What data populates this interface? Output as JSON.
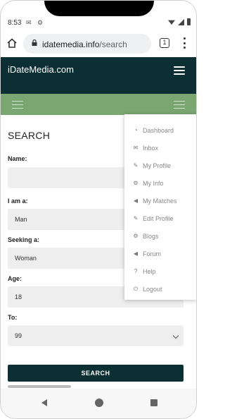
{
  "status": {
    "time": "8:53",
    "left_icons": "✉ ⚙"
  },
  "browser": {
    "url_host": "idatemedia.info",
    "url_path": "/search",
    "tab_count": "1"
  },
  "site": {
    "brand": "iDateMedia.com"
  },
  "form": {
    "title": "SEARCH",
    "name_label": "Name:",
    "name_value": "",
    "iam_label": "I am a:",
    "iam_value": "Man",
    "seeking_label": "Seeking a:",
    "seeking_value": "Woman",
    "age_label": "Age:",
    "age_value": "18",
    "to_label": "To:",
    "to_value": "99",
    "search_button": "SEARCH"
  },
  "menu": {
    "items": [
      {
        "label": "Dashboard",
        "icon": "dashboard-icon",
        "glyph": "◔"
      },
      {
        "label": "Inbox",
        "icon": "envelope-icon",
        "glyph": "✉"
      },
      {
        "label": "My Profile",
        "icon": "edit-icon",
        "glyph": "✎"
      },
      {
        "label": "My Info",
        "icon": "cogs-icon",
        "glyph": "⚙"
      },
      {
        "label": "My Matches",
        "icon": "bullhorn-icon",
        "glyph": "◀"
      },
      {
        "label": "Edit Profile",
        "icon": "edit-icon",
        "glyph": "✎"
      },
      {
        "label": "Blogs",
        "icon": "cogs-icon",
        "glyph": "⚙"
      },
      {
        "label": "Forum",
        "icon": "bullhorn-icon",
        "glyph": "◀"
      },
      {
        "label": "Help",
        "icon": "question-icon",
        "glyph": "?"
      },
      {
        "label": "Logout",
        "icon": "power-icon",
        "glyph": "⏻"
      }
    ]
  }
}
